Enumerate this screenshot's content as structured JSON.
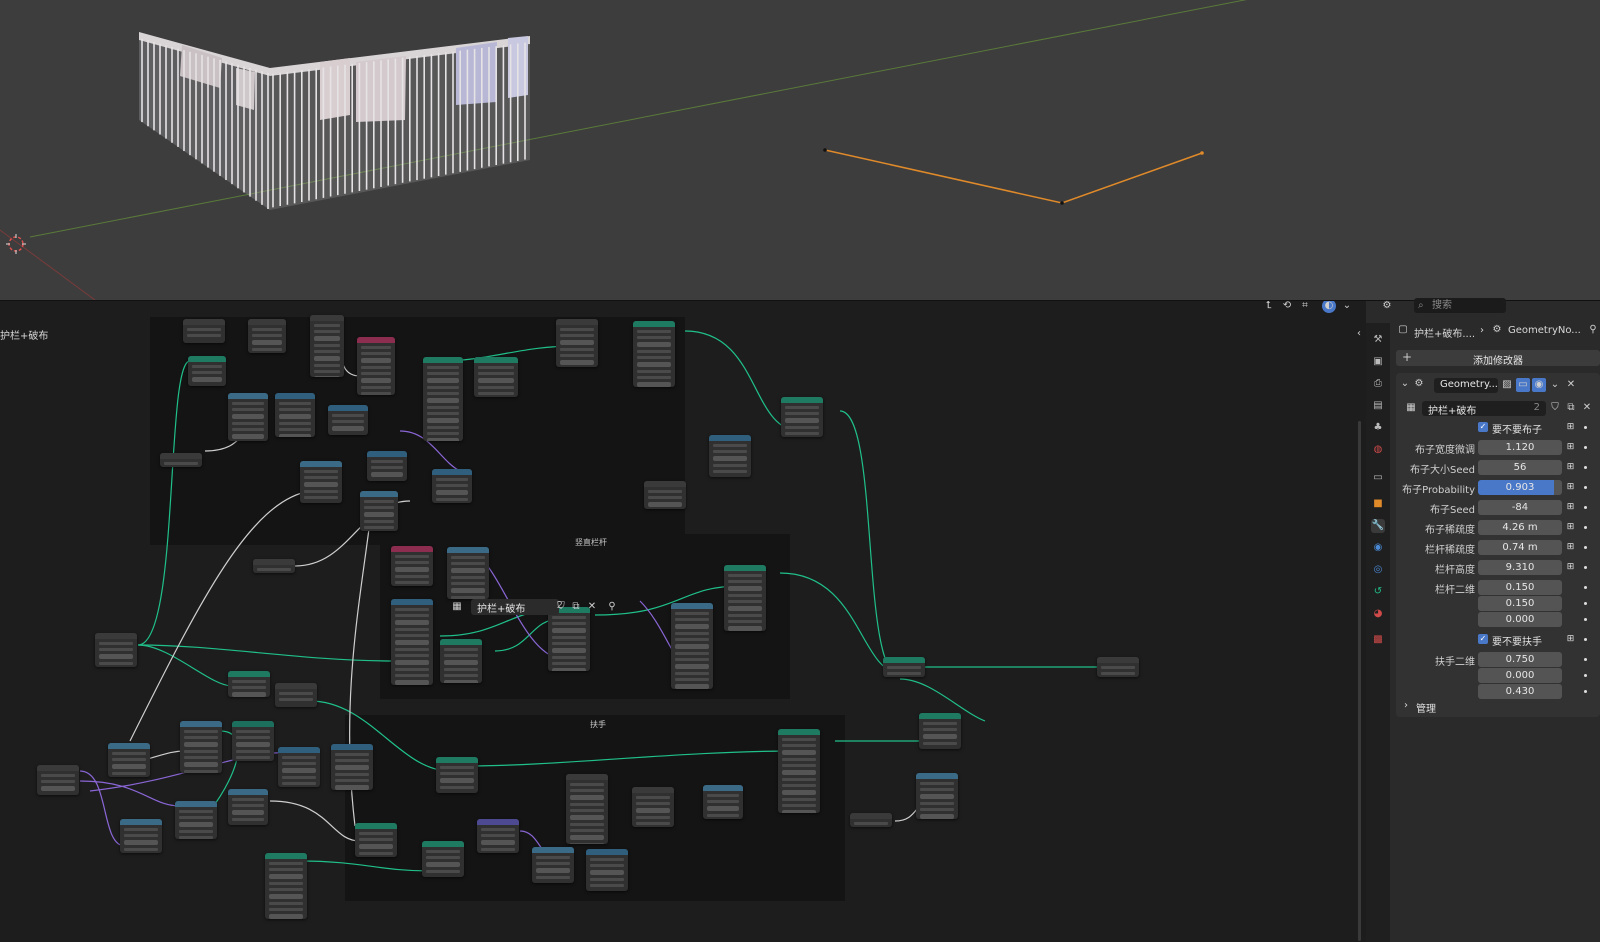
{
  "viewport": {
    "axis_x_color": "#7a3b3b",
    "axis_y_color": "#5a7a3a",
    "curve_color": "#e08a2a",
    "model_color": "#cfcfcf"
  },
  "node_editor": {
    "tree_name": "护栏+破布",
    "user_count": "2",
    "breadcrumb_left": "护栏+破布",
    "frames": {
      "vertical_rails": "竖直栏杆",
      "handrail": "扶手"
    }
  },
  "properties": {
    "search_placeholder": "搜索",
    "breadcrumb": {
      "object": "护栏+破布....",
      "modifier": "GeometryNo..."
    },
    "add_modifier_label": "添加修改器",
    "modifier": {
      "name": "Geometry...",
      "node_group": "护栏+破布",
      "node_group_users": "2",
      "inputs": [
        {
          "label": "要不要布子",
          "kind": "checkbox",
          "checked": true
        },
        {
          "label": "布子宽度微调",
          "kind": "value",
          "value": "1.120"
        },
        {
          "label": "布子大小Seed",
          "kind": "value",
          "value": "56"
        },
        {
          "label": "布子Probability",
          "kind": "value",
          "value": "0.903",
          "progress": 0.903
        },
        {
          "label": "布子Seed",
          "kind": "value",
          "value": "-84"
        },
        {
          "label": "布子稀疏度",
          "kind": "value",
          "value": "4.26 m"
        },
        {
          "label": "栏杆稀疏度",
          "kind": "value",
          "value": "0.74 m"
        },
        {
          "label": "栏杆高度",
          "kind": "value",
          "value": "9.310"
        },
        {
          "label": "栏杆二维",
          "kind": "vector",
          "values": [
            "0.150",
            "0.150",
            "0.000"
          ]
        },
        {
          "label": "要不要扶手",
          "kind": "checkbox",
          "checked": true
        },
        {
          "label": "扶手二维",
          "kind": "vector",
          "values": [
            "0.750",
            "0.000",
            "0.430"
          ]
        }
      ],
      "manage_label": "管理"
    }
  }
}
